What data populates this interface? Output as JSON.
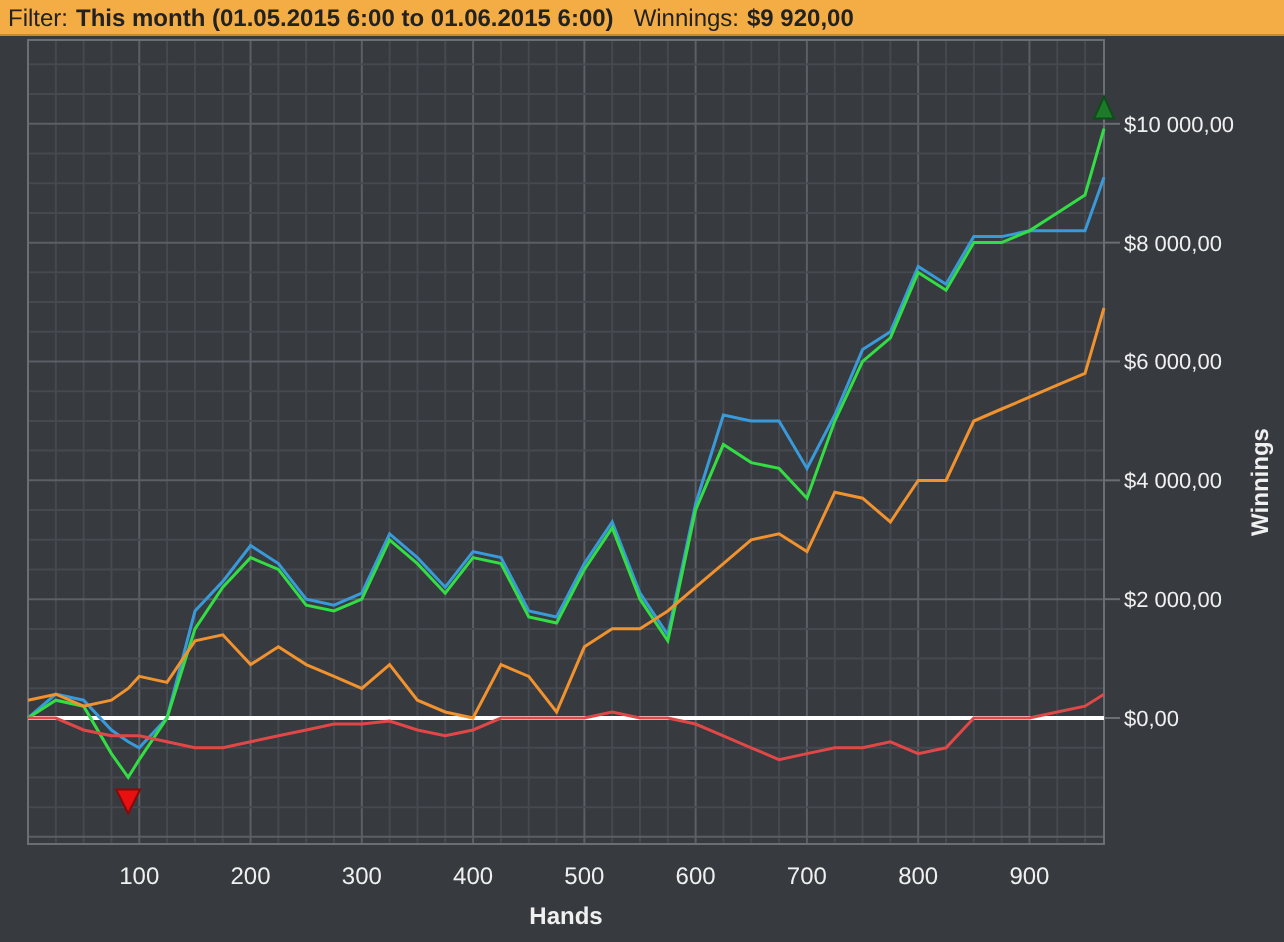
{
  "header": {
    "filter": {
      "label": "Filter:",
      "value": "This month (01.05.2015 6:00 to 01.06.2015 6:00)"
    },
    "winnings": {
      "label": "Winnings:",
      "value": "$9 920,00"
    }
  },
  "chart": {
    "chart_data": {
      "type": "line",
      "xlabel": "Hands",
      "ylabel": "Winnings",
      "x": [
        0,
        25,
        50,
        75,
        90,
        100,
        125,
        150,
        175,
        200,
        225,
        250,
        275,
        300,
        325,
        350,
        375,
        400,
        425,
        450,
        475,
        500,
        525,
        550,
        575,
        600,
        625,
        650,
        675,
        700,
        725,
        750,
        775,
        800,
        825,
        850,
        875,
        900,
        925,
        950,
        967
      ],
      "series": [
        {
          "color": "#3a9ad9",
          "values": [
            0,
            400,
            300,
            -200,
            -400,
            -500,
            0,
            1800,
            2300,
            2900,
            2600,
            2000,
            1900,
            2100,
            3100,
            2700,
            2200,
            2800,
            2700,
            1800,
            1700,
            2600,
            3300,
            2100,
            1400,
            3600,
            5100,
            5000,
            5000,
            4200,
            5100,
            6200,
            6500,
            7600,
            7300,
            8100,
            8100,
            8200,
            8200,
            8200,
            9100
          ]
        },
        {
          "color": "#33dd44",
          "values": [
            0,
            300,
            200,
            -600,
            -1000,
            -700,
            0,
            1500,
            2200,
            2700,
            2500,
            1900,
            1800,
            2000,
            3000,
            2600,
            2100,
            2700,
            2600,
            1700,
            1600,
            2500,
            3200,
            2000,
            1300,
            3500,
            4600,
            4300,
            4200,
            3700,
            5000,
            6000,
            6400,
            7500,
            7200,
            8000,
            8000,
            8200,
            8500,
            8800,
            9920
          ]
        },
        {
          "color": "#f0922e",
          "values": [
            300,
            400,
            200,
            300,
            500,
            700,
            600,
            1300,
            1400,
            900,
            1200,
            900,
            700,
            500,
            900,
            300,
            100,
            0,
            900,
            700,
            100,
            1200,
            1500,
            1500,
            1800,
            2200,
            2600,
            3000,
            3100,
            2800,
            3800,
            3700,
            3300,
            4000,
            4000,
            5000,
            5200,
            5400,
            5600,
            5800,
            6900
          ]
        },
        {
          "color": "#e04848",
          "values": [
            0,
            0,
            -200,
            -300,
            -300,
            -300,
            -400,
            -500,
            -500,
            -400,
            -300,
            -200,
            -100,
            -100,
            -50,
            -200,
            -300,
            -200,
            0,
            0,
            0,
            0,
            100,
            0,
            0,
            -100,
            -300,
            -500,
            -700,
            -600,
            -500,
            -500,
            -400,
            -600,
            -500,
            0,
            0,
            0,
            100,
            200,
            400
          ]
        }
      ],
      "xlim": [
        0,
        967
      ],
      "ylim": [
        -2120,
        11410
      ],
      "xticks": [
        100,
        200,
        300,
        400,
        500,
        600,
        700,
        800,
        900
      ],
      "yticks": [
        {
          "value": 0,
          "label": "$0,00"
        },
        {
          "value": 2000,
          "label": "$2 000,00"
        },
        {
          "value": 4000,
          "label": "$4 000,00"
        },
        {
          "value": 6000,
          "label": "$6 000,00"
        },
        {
          "value": 8000,
          "label": "$8 000,00"
        },
        {
          "value": 10000,
          "label": "$10 000,00"
        }
      ],
      "grid": true
    }
  }
}
